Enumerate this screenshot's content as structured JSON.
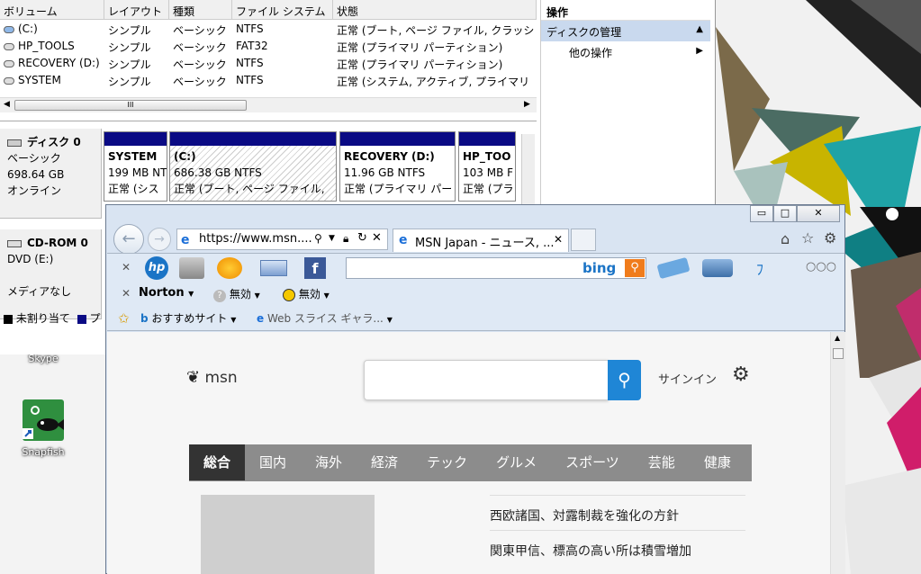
{
  "disk_mgmt": {
    "columns": [
      "ボリューム",
      "レイアウト",
      "種類",
      "ファイル システム",
      "状態"
    ],
    "volumes": [
      {
        "name": "(C:)",
        "layout": "シンプル",
        "type": "ベーシック",
        "fs": "NTFS",
        "status": "正常 (ブート, ページ ファイル, クラッシ"
      },
      {
        "name": "HP_TOOLS",
        "layout": "シンプル",
        "type": "ベーシック",
        "fs": "FAT32",
        "status": "正常 (プライマリ パーティション)"
      },
      {
        "name": "RECOVERY (D:)",
        "layout": "シンプル",
        "type": "ベーシック",
        "fs": "NTFS",
        "status": "正常 (プライマリ パーティション)"
      },
      {
        "name": "SYSTEM",
        "layout": "シンプル",
        "type": "ベーシック",
        "fs": "NTFS",
        "status": "正常 (システム, アクティブ, プライマリ"
      }
    ],
    "scroll_grip": "III",
    "disk0": {
      "title": "ディスク 0",
      "type": "ベーシック",
      "size": "698.64 GB",
      "state": "オンライン"
    },
    "partitions": [
      {
        "name": "SYSTEM",
        "size": "199 MB NT",
        "status": "正常 (シス"
      },
      {
        "name": "(C:)",
        "size": "686.38 GB NTFS",
        "status": "正常 (ブート, ページ ファイル,"
      },
      {
        "name": "RECOVERY  (D:)",
        "size": "11.96 GB NTFS",
        "status": "正常 (プライマリ パー"
      },
      {
        "name": "HP_TOO",
        "size": "103 MB F",
        "status": "正常 (プラ"
      }
    ],
    "cdrom": {
      "title": "CD-ROM 0",
      "drive": "DVD (E:)",
      "media": "メディアなし"
    },
    "legend": [
      {
        "label": "未割り当て",
        "color": "#000000"
      },
      {
        "label": "プ",
        "color": "#0a0a84"
      }
    ],
    "actions": {
      "header": "操作",
      "item": "ディスクの管理",
      "sub": "他の操作"
    }
  },
  "desktop": {
    "icons": [
      {
        "label": "Skype"
      },
      {
        "label": "Snapfish"
      }
    ]
  },
  "ie": {
    "address": "https://www.msn....",
    "tab_title": "MSN Japan - ニュース, ...",
    "bing": "bing",
    "norton": "Norton",
    "norton_opt1": "無効",
    "norton_opt2": "無効",
    "fav1": "おすすめサイト",
    "fav2": "Web スライス ギャラ..."
  },
  "msn": {
    "logo": "msn",
    "signin": "サインイン",
    "nav": [
      "総合",
      "国内",
      "海外",
      "経済",
      "テック",
      "グルメ",
      "スポーツ",
      "芸能",
      "健康"
    ],
    "nav_active_color": "#333333",
    "nav_color": "#8c8c8c",
    "search_color": "#1f86d6",
    "headlines": [
      "西欧諸国、対露制裁を強化の方針",
      "関東甲信、標高の高い所は積雪増加"
    ]
  }
}
